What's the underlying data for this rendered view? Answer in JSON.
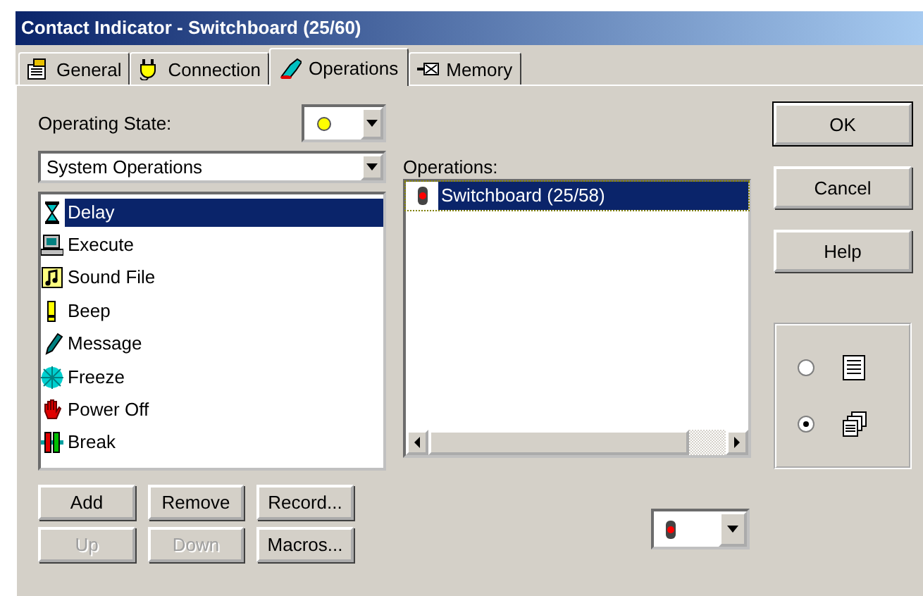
{
  "window": {
    "title": "Contact Indicator - Switchboard (25/60)"
  },
  "tabs": [
    {
      "label": "General",
      "kind": "general",
      "selected": false
    },
    {
      "label": "Connection",
      "kind": "connection",
      "selected": false
    },
    {
      "label": "Operations",
      "kind": "operations",
      "selected": true
    },
    {
      "label": "Memory",
      "kind": "memory",
      "selected": false
    }
  ],
  "operating_state": {
    "label": "Operating State:"
  },
  "category": {
    "value": "System Operations"
  },
  "available": [
    {
      "label": "Delay",
      "kind": "delay",
      "selected": true
    },
    {
      "label": "Execute",
      "kind": "execute",
      "selected": false
    },
    {
      "label": "Sound File",
      "kind": "sound",
      "selected": false
    },
    {
      "label": "Beep",
      "kind": "beep",
      "selected": false
    },
    {
      "label": "Message",
      "kind": "message",
      "selected": false
    },
    {
      "label": "Freeze",
      "kind": "freeze",
      "selected": false
    },
    {
      "label": "Power Off",
      "kind": "poweroff",
      "selected": false
    },
    {
      "label": "Break",
      "kind": "break",
      "selected": false
    }
  ],
  "operations": {
    "label": "Operations:",
    "items": [
      {
        "label": "Switchboard (25/58)",
        "selected": true
      }
    ]
  },
  "buttons": [
    {
      "label": "Add",
      "disabled": false
    },
    {
      "label": "Remove",
      "disabled": false
    },
    {
      "label": "Record...",
      "disabled": false
    },
    {
      "label": "Up",
      "disabled": true
    },
    {
      "label": "Down",
      "disabled": true
    },
    {
      "label": "Macros...",
      "disabled": false
    }
  ],
  "dialog_buttons": [
    {
      "label": "OK",
      "default": true
    },
    {
      "label": "Cancel",
      "default": false
    },
    {
      "label": "Help",
      "default": false
    }
  ],
  "view_options": [
    {
      "kind": "list",
      "selected": false
    },
    {
      "kind": "cascade",
      "selected": true
    }
  ]
}
